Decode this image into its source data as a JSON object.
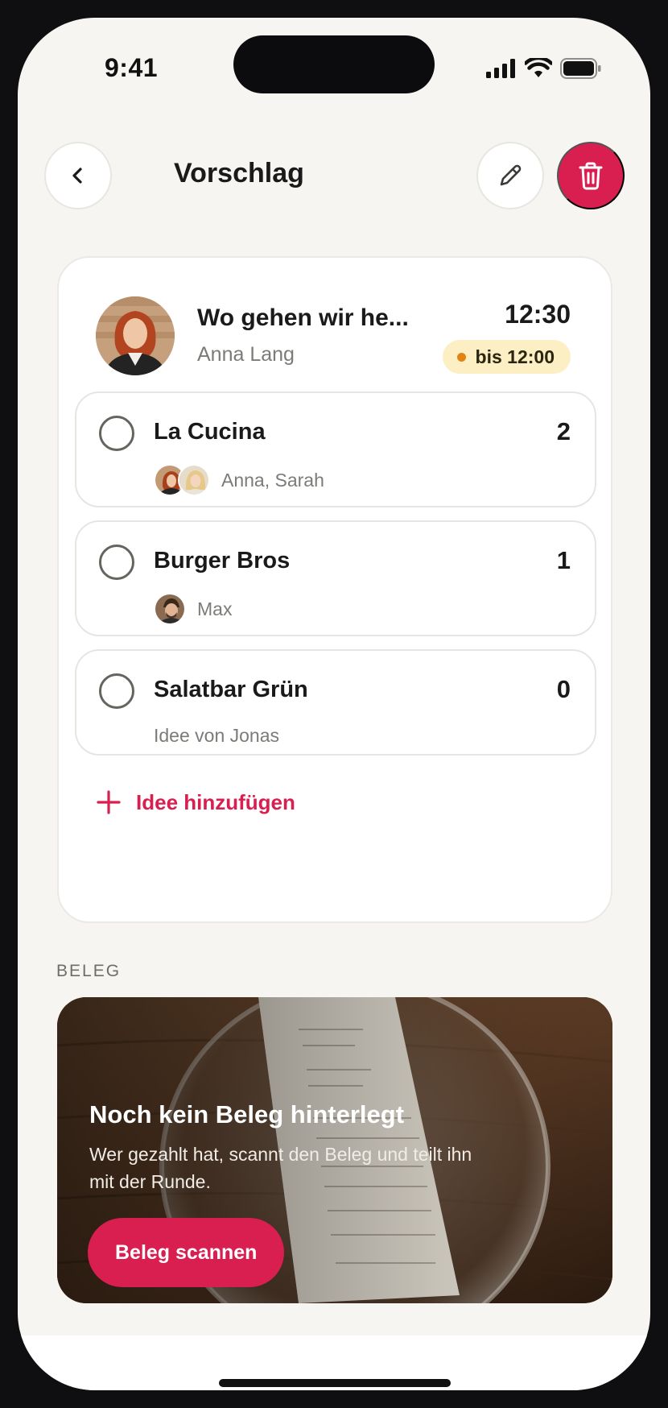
{
  "status_bar": {
    "time": "9:41",
    "icons": [
      "cellular-signal-icon",
      "wifi-icon",
      "battery-icon"
    ]
  },
  "header": {
    "title": "Vorschlag",
    "back_icon": "chevron-left-icon",
    "edit_icon": "pencil-icon",
    "delete_icon": "trash-icon"
  },
  "poll": {
    "title": "Wo gehen wir he...",
    "author": "Anna Lang",
    "time": "12:30",
    "deadline": "bis 12:00",
    "options": [
      {
        "name": "La Cucina",
        "count": "2",
        "voters": "Anna, Sarah"
      },
      {
        "name": "Burger Bros",
        "count": "1",
        "voters": "Max"
      },
      {
        "name": "Salatbar Grün",
        "count": "0",
        "idea_by": "Idee von Jonas"
      }
    ],
    "add_idea_label": "Idee hinzufügen"
  },
  "receipt": {
    "section_label": "BELEG",
    "title": "Noch kein Beleg hinterlegt",
    "text": "Wer gezahlt hat, scannt den Beleg und teilt ihn mit der Runde.",
    "button_label": "Beleg scannen"
  },
  "colors": {
    "accent": "#d81f50",
    "background": "#f6f5f1",
    "badge_bg": "#fcefc4",
    "badge_dot": "#e28413"
  }
}
